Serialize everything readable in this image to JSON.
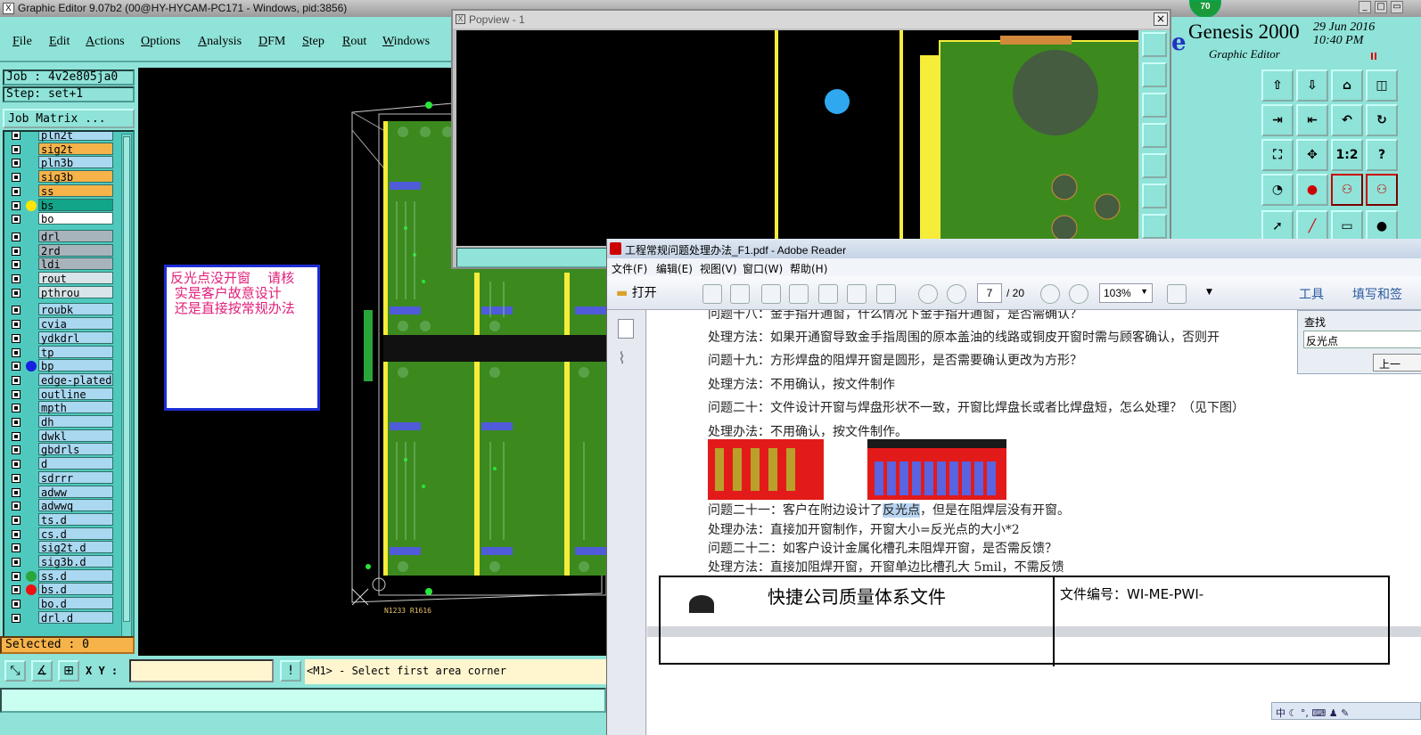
{
  "genesis": {
    "title": "Graphic Editor 9.07b2 (00@HY-HYCAM-PC171 - Windows, pid:3856)",
    "menu": [
      "File",
      "Edit",
      "Actions",
      "Options",
      "Analysis",
      "DFM",
      "Step",
      "Rout",
      "Windows"
    ],
    "job": "Job : 4v2e805ja0",
    "step": "Step: set+1",
    "job_matrix": "Job Matrix ...",
    "layers": [
      {
        "name": "pln2t",
        "bg": "#a9d8f0",
        "dot": ""
      },
      {
        "name": "sig2t",
        "bg": "#f6b34a",
        "dot": ""
      },
      {
        "name": "pln3b",
        "bg": "#a9d8f0",
        "dot": ""
      },
      {
        "name": "sig3b",
        "bg": "#f6b34a",
        "dot": ""
      },
      {
        "name": "ss",
        "bg": "#f6b34a",
        "dot": ""
      },
      {
        "name": "bs",
        "bg": "#13a58a",
        "dot": "#ffe600"
      },
      {
        "name": "bo",
        "bg": "#ffffff",
        "dot": ""
      },
      {
        "name": "drl",
        "bg": "#a8b4bc",
        "dot": ""
      },
      {
        "name": "2rd",
        "bg": "#a8b4bc",
        "dot": ""
      },
      {
        "name": "ldi",
        "bg": "#a8b4bc",
        "dot": ""
      },
      {
        "name": "rout",
        "bg": "#d9e4e8",
        "dot": ""
      },
      {
        "name": "pthrou",
        "bg": "#d9e4e8",
        "dot": ""
      },
      {
        "name": "roubk",
        "bg": "#a9d8f0",
        "dot": ""
      },
      {
        "name": "cvia",
        "bg": "#a9d8f0",
        "dot": ""
      },
      {
        "name": "ydkdrl",
        "bg": "#a9d8f0",
        "dot": ""
      },
      {
        "name": "tp",
        "bg": "#a9d8f0",
        "dot": ""
      },
      {
        "name": "bp",
        "bg": "#a9d8f0",
        "dot": "#1520e0"
      },
      {
        "name": "edge-plated",
        "bg": "#a9d8f0",
        "dot": ""
      },
      {
        "name": "outline",
        "bg": "#a9d8f0",
        "dot": ""
      },
      {
        "name": "mpth",
        "bg": "#a9d8f0",
        "dot": ""
      },
      {
        "name": "dh",
        "bg": "#a9d8f0",
        "dot": ""
      },
      {
        "name": "dwkl",
        "bg": "#a9d8f0",
        "dot": ""
      },
      {
        "name": "gbdrls",
        "bg": "#a9d8f0",
        "dot": ""
      },
      {
        "name": "d",
        "bg": "#a9d8f0",
        "dot": ""
      },
      {
        "name": "sdrrr",
        "bg": "#a9d8f0",
        "dot": ""
      },
      {
        "name": "adww",
        "bg": "#a9d8f0",
        "dot": ""
      },
      {
        "name": "adwwq",
        "bg": "#a9d8f0",
        "dot": ""
      },
      {
        "name": "ts.d",
        "bg": "#a9d8f0",
        "dot": ""
      },
      {
        "name": "cs.d",
        "bg": "#a9d8f0",
        "dot": ""
      },
      {
        "name": "sig2t.d",
        "bg": "#a9d8f0",
        "dot": ""
      },
      {
        "name": "sig3b.d",
        "bg": "#a9d8f0",
        "dot": ""
      },
      {
        "name": "ss.d",
        "bg": "#a9d8f0",
        "dot": "#2aa53a"
      },
      {
        "name": "bs.d",
        "bg": "#a9d8f0",
        "dot": "#ee1010"
      },
      {
        "name": "bo.d",
        "bg": "#a9d8f0",
        "dot": ""
      },
      {
        "name": "drl.d",
        "bg": "#a9d8f0",
        "dot": ""
      }
    ],
    "selected": "Selected : 0",
    "xy_label": "X Y :",
    "prompt": "<M1> - Select first area corner",
    "canvas_label": "N1233 R1616",
    "brand_name": "Genesis 2000",
    "brand_e": "e",
    "brand_sub": "Graphic Editor",
    "date": "29 Jun 2016",
    "time": "10:40 PM",
    "badge": "70",
    "tool_labels": [
      "1:2",
      "?"
    ]
  },
  "popview": {
    "title": "Popview - 1"
  },
  "note": {
    "text": "反光点没开窗    请核\n 实是客户故意设计\n 还是直接按常规办法"
  },
  "reader": {
    "title": "工程常规问题处理办法_F1.pdf - Adobe Reader",
    "menu": [
      "文件(F)",
      "编辑(E)",
      "视图(V)",
      "窗口(W)",
      "帮助(H)"
    ],
    "open_label": "打开",
    "page": "7",
    "pages": "/ 20",
    "zoom": "103%",
    "tools": "工具",
    "fill_sign": "填写和签",
    "find_label": "查找",
    "find_value": "反光点",
    "find_prev": "上一",
    "lines": [
      "问题十八：金手指开通窗，什么情况下金手指开通窗，是否需确认？",
      "处理方法：如果开通窗导致金手指周围的原本盖油的线路或铜皮开窗时需与顾客确认，否则开",
      "问题十九：方形焊盘的阻焊开窗是圆形，是否需要确认更改为方形？",
      "处理方法：不用确认，按文件制作",
      "问题二十：文件设计开窗与焊盘形状不一致，开窗比焊盘长或者比焊盘短，怎么处理？（见下图）",
      "处理办法：不用确认，按文件制作。"
    ],
    "q21_pre": "问题二十一：客户在附边设计了",
    "q21_hl": "反光点",
    "q21_post": "，但是在阻焊层没有开窗。",
    "lines2": [
      "处理办法：直接加开窗制作，开窗大小=反光点的大小*2",
      "问题二十二：如客户设计金属化槽孔未阻焊开窗，是否需反馈？",
      "处理方法：直接加阻焊开窗，开窗单边比槽孔大 5mil，不需反馈"
    ],
    "page2_title": "快捷公司质量体系文件",
    "page2_code": "文件编号：WI-ME-PWI-"
  },
  "ime": {
    "text": "中 ☾ °, ⌨ ♟ ✎"
  }
}
